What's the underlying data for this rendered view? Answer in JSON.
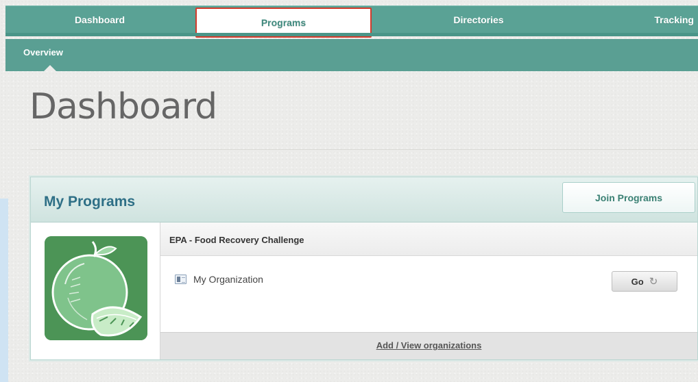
{
  "nav": {
    "tabs": [
      {
        "label": "Dashboard"
      },
      {
        "label": "Programs"
      },
      {
        "label": "Directories"
      },
      {
        "label": "Tracking"
      }
    ],
    "highlighted_tab": "Programs",
    "highlight_color": "#d33b2c"
  },
  "subnav": {
    "items": [
      {
        "label": "Overview"
      }
    ]
  },
  "page": {
    "title": "Dashboard"
  },
  "my_programs": {
    "title": "My Programs",
    "join_label": "Join Programs",
    "program": {
      "name": "EPA - Food Recovery Challenge",
      "logo_icon": "apple-lime-icon",
      "organizations": [
        {
          "name": "My Organization",
          "icon": "org-card-icon",
          "action_label": "Go"
        }
      ],
      "footer_link": "Add / View organizations"
    }
  },
  "colors": {
    "nav_green": "#5aa295",
    "title_blue": "#2e6f86",
    "logo_green": "#4c9456"
  }
}
